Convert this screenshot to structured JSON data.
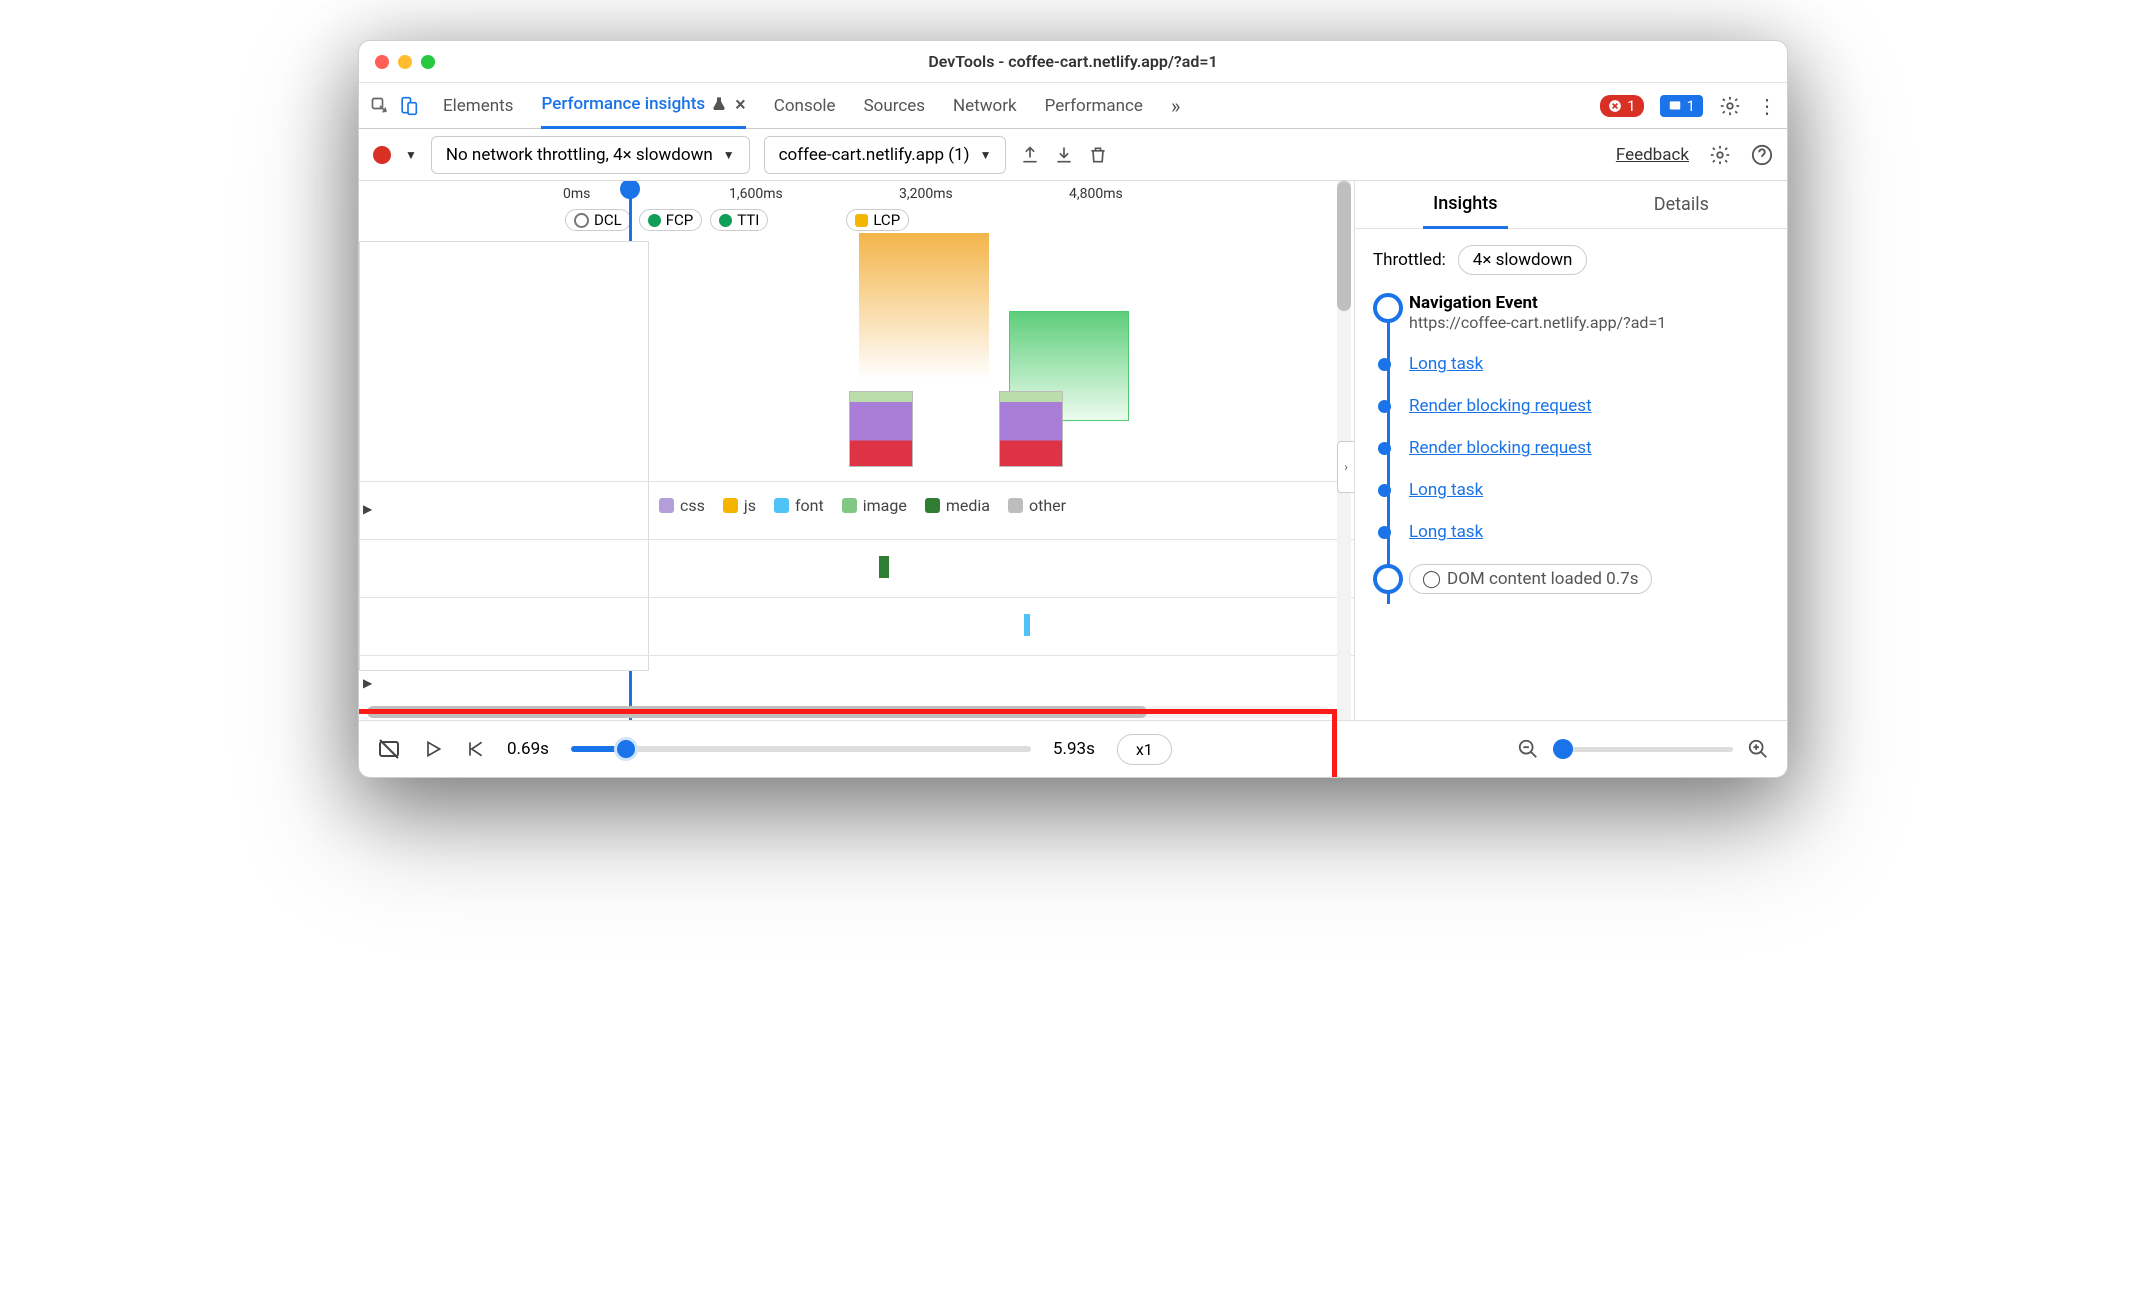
{
  "window": {
    "title": "DevTools - coffee-cart.netlify.app/?ad=1"
  },
  "tabs": {
    "items": [
      "Elements",
      "Performance insights",
      "Console",
      "Sources",
      "Network",
      "Performance"
    ],
    "active": 1,
    "close_active": "×",
    "overflow": "»"
  },
  "status": {
    "errors": "1",
    "messages": "1"
  },
  "toolbar": {
    "throttling": "No network throttling, 4× slowdown",
    "session": "coffee-cart.netlify.app (1)",
    "feedback": "Feedback"
  },
  "timeline": {
    "ticks": [
      "0ms",
      "1,600ms",
      "3,200ms",
      "4,800ms"
    ],
    "markers": {
      "dcl": "DCL",
      "fcp": "FCP",
      "tti": "TTI",
      "lcp": "LCP"
    },
    "legend": {
      "css": "css",
      "js": "js",
      "font": "font",
      "image": "image",
      "media": "media",
      "other": "other"
    }
  },
  "sidebar": {
    "tabs": {
      "insights": "Insights",
      "details": "Details"
    },
    "throttled_label": "Throttled:",
    "throttled_value": "4× slowdown",
    "events": {
      "nav_title": "Navigation Event",
      "nav_url": "https://coffee-cart.netlify.app/?ad=1",
      "items": [
        "Long task",
        "Render blocking request",
        "Render blocking request",
        "Long task",
        "Long task"
      ],
      "dcl": "DOM content loaded 0.7s"
    }
  },
  "footer": {
    "time_start": "0.69s",
    "time_end": "5.93s",
    "speed": "x1"
  }
}
